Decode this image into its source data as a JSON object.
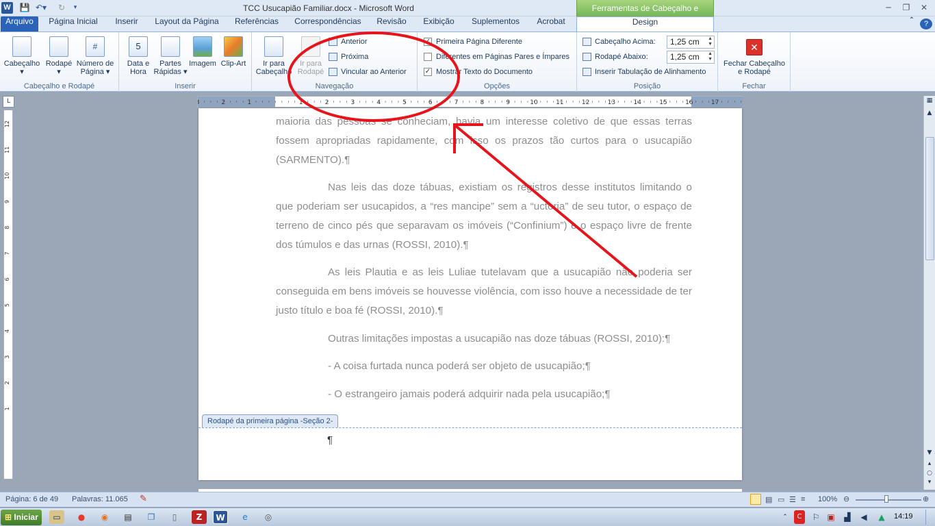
{
  "window": {
    "title": "TCC Usucapião Familiar.docx - Microsoft Word",
    "context_tab_header": "Ferramentas de Cabeçalho e Rodapé",
    "app_icon": "W"
  },
  "tabs": [
    {
      "label": "Arquivo"
    },
    {
      "label": "Página Inicial"
    },
    {
      "label": "Inserir"
    },
    {
      "label": "Layout da Página"
    },
    {
      "label": "Referências"
    },
    {
      "label": "Correspondências"
    },
    {
      "label": "Revisão"
    },
    {
      "label": "Exibição"
    },
    {
      "label": "Suplementos"
    },
    {
      "label": "Acrobat"
    },
    {
      "label": "Design"
    }
  ],
  "ribbon": {
    "header_footer_group": {
      "label": "Cabeçalho e Rodapé",
      "header": "Cabeçalho",
      "footer": "Rodapé",
      "page_number_1": "Número de",
      "page_number_2": "Página"
    },
    "insert_group": {
      "label": "Inserir",
      "date_1": "Data e",
      "date_2": "Hora",
      "parts_1": "Partes",
      "parts_2": "Rápidas",
      "image": "Imagem",
      "clipart": "Clip-Art"
    },
    "navigation_group": {
      "label": "Navegação",
      "goto_header_1": "Ir para",
      "goto_header_2": "Cabeçalho",
      "goto_footer_1": "Ir para",
      "goto_footer_2": "Rodapé",
      "previous": "Anterior",
      "next": "Próxima",
      "link_previous": "Vincular ao Anterior"
    },
    "options_group": {
      "label": "Opções",
      "first_page": "Primeira Página Diferente",
      "odd_even": "Diferentes em Páginas Pares e Ímpares",
      "show_text": "Mostrar Texto do Documento",
      "check_mark": "✓"
    },
    "position_group": {
      "label": "Posição",
      "header_top": "Cabeçalho Acima:",
      "header_top_value": "1,25 cm",
      "footer_bottom": "Rodapé Abaixo:",
      "footer_bottom_value": "1,25 cm",
      "insert_tab": "Inserir Tabulação de Alinhamento"
    },
    "close_group": {
      "label": "Fechar",
      "close_1": "Fechar Cabeçalho",
      "close_2": "e Rodapé"
    }
  },
  "document": {
    "p1": "maioria das pessoas se conheciam, havia um interesse coletivo de que essas terras fossem apropriadas rapidamente, com isso os prazos tão curtos para o usucapião (SARMENTO).¶",
    "p2": "Nas leis das doze tábuas, existiam os registros desse institutos limitando o que poderiam ser usucapidos, a “res mancipe” sem a “uctoria” de seu tutor, o espaço de terreno de cinco pés que separavam os imóveis (“Confinium”) e o espaço livre de frente dos túmulos e das urnas (ROSSI, 2010).¶",
    "p3": "As leis Plautia e as leis Luliae tutelavam que a usucapião não poderia ser conseguida em bens imóveis se houvesse violência, com isso houve a necessidade de ter justo título e boa fé (ROSSI, 2010).¶",
    "p4": "Outras limitações impostas a usucapião nas doze tábuas (ROSSI, 2010):¶",
    "p5": "- A coisa furtada nunca poderá ser objeto de usucapião;¶",
    "p6": "- O estrangeiro jamais poderá adquirir nada pela usucapião;¶",
    "footer_tag": "Rodapé da primeira página -Seção 2-",
    "footer_mark": "¶"
  },
  "ruler": {
    "labels": [
      "3",
      "2",
      "1",
      "1",
      "2",
      "3",
      "4",
      "5",
      "6",
      "7",
      "8",
      "9",
      "10",
      "11",
      "12",
      "13",
      "14",
      "15",
      "16",
      "17"
    ],
    "v_labels": [
      "12",
      "11",
      "10",
      "9",
      "8",
      "7",
      "6",
      "5",
      "4",
      "3",
      "2",
      "1"
    ]
  },
  "status": {
    "page": "Página: 6 de 49",
    "words": "Palavras: 11.065",
    "zoom": "100%"
  },
  "taskbar": {
    "start": "Iniciar",
    "time": "14:19"
  },
  "colors": {
    "annotation": "#e8141c",
    "file_tab": "#2b63b8",
    "context_green": "#74b65a"
  }
}
